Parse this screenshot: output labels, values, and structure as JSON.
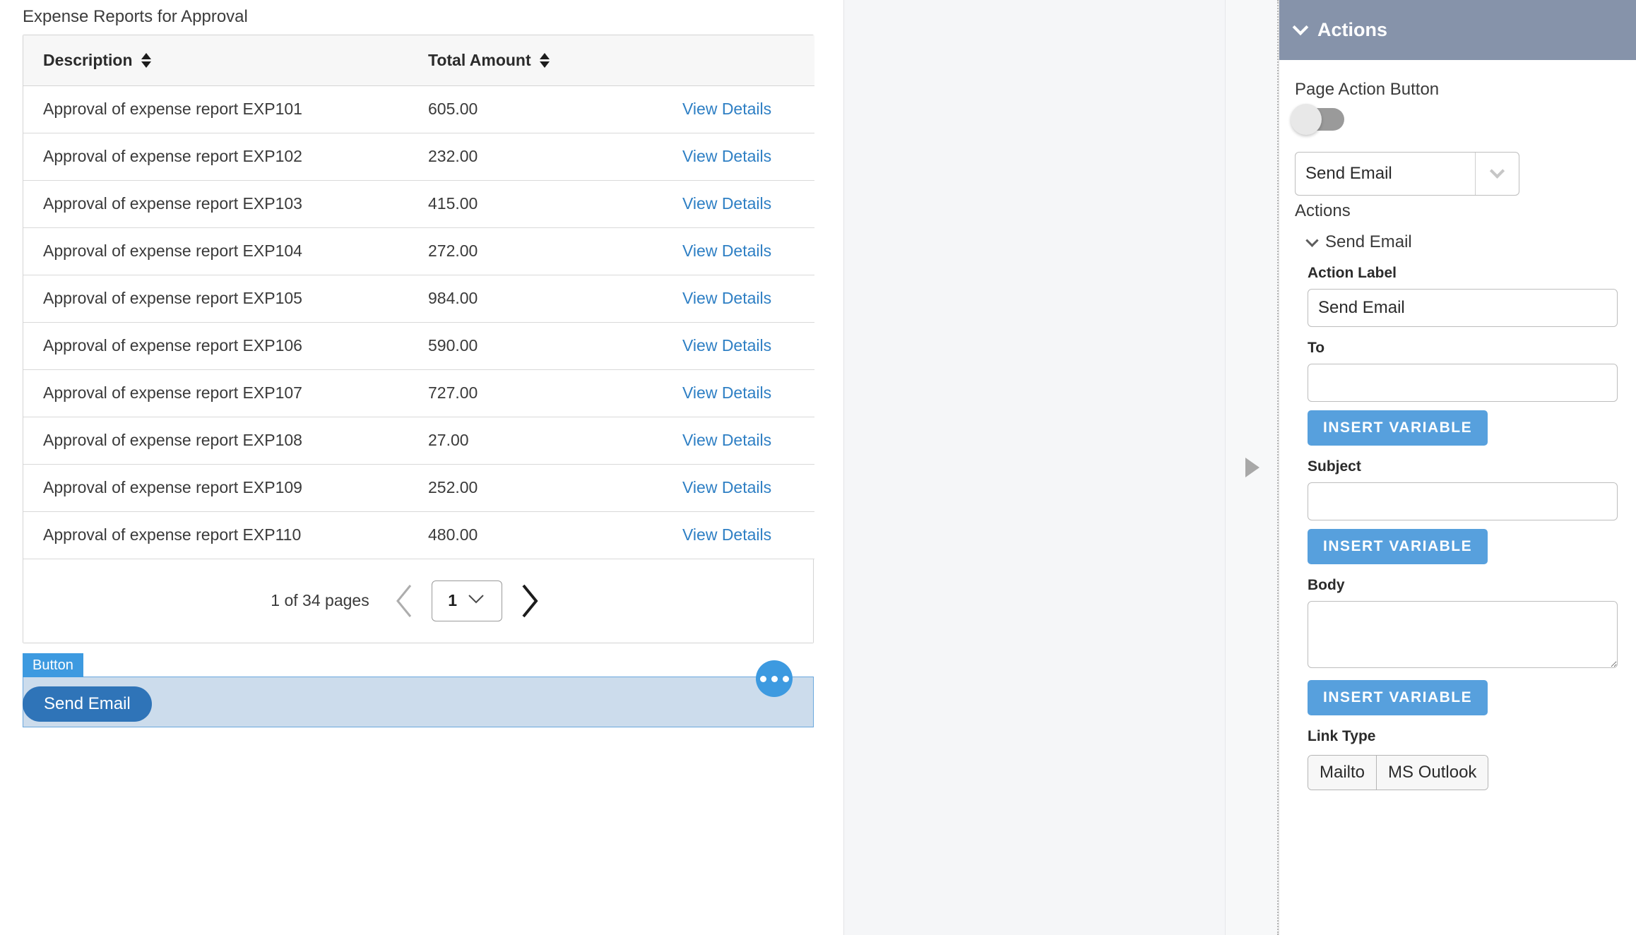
{
  "canvas": {
    "page_title": "Expense Reports for Approval",
    "table": {
      "columns": [
        {
          "label": "Description",
          "sort_icon": "sort-updown-icon"
        },
        {
          "label": "Total Amount",
          "sort_icon": "sort-updown-icon"
        },
        {
          "label": ""
        }
      ],
      "rows": [
        {
          "description": "Approval of expense report EXP101",
          "amount": "605.00",
          "action": "View Details"
        },
        {
          "description": "Approval of expense report EXP102",
          "amount": "232.00",
          "action": "View Details"
        },
        {
          "description": "Approval of expense report EXP103",
          "amount": "415.00",
          "action": "View Details"
        },
        {
          "description": "Approval of expense report EXP104",
          "amount": "272.00",
          "action": "View Details"
        },
        {
          "description": "Approval of expense report EXP105",
          "amount": "984.00",
          "action": "View Details"
        },
        {
          "description": "Approval of expense report EXP106",
          "amount": "590.00",
          "action": "View Details"
        },
        {
          "description": "Approval of expense report EXP107",
          "amount": "727.00",
          "action": "View Details"
        },
        {
          "description": "Approval of expense report EXP108",
          "amount": "27.00",
          "action": "View Details"
        },
        {
          "description": "Approval of expense report EXP109",
          "amount": "252.00",
          "action": "View Details"
        },
        {
          "description": "Approval of expense report EXP110",
          "amount": "480.00",
          "action": "View Details"
        }
      ]
    },
    "pagination": {
      "summary": "1 of 34 pages",
      "current_page": "1",
      "prev_icon": "chevron-left-icon",
      "next_icon": "chevron-right-icon",
      "page_dropdown_icon": "chevron-down-icon"
    },
    "selected_widget": {
      "badge": "Button",
      "button_label": "Send Email",
      "handle_icon": "ellipsis-icon"
    }
  },
  "gutter": {
    "expand_icon": "triangle-right-icon"
  },
  "properties": {
    "header": {
      "title": "Actions",
      "collapse_icon": "chevron-down-icon"
    },
    "page_action_button": {
      "label": "Page Action Button",
      "toggle_state": "off"
    },
    "action_select": {
      "value": "Send Email",
      "arrow_icon": "chevron-down-icon"
    },
    "actions_caption": "Actions",
    "action_group": {
      "title": "Send Email",
      "collapse_icon": "chevron-down-icon",
      "fields": {
        "action_label": {
          "label": "Action Label",
          "value": "Send Email"
        },
        "to": {
          "label": "To",
          "value": "",
          "button": "INSERT VARIABLE"
        },
        "subject": {
          "label": "Subject",
          "value": "",
          "button": "INSERT VARIABLE"
        },
        "body": {
          "label": "Body",
          "value": "",
          "button": "INSERT VARIABLE"
        },
        "link_type": {
          "label": "Link Type",
          "options": [
            "Mailto",
            "MS Outlook"
          ]
        }
      }
    }
  },
  "colors": {
    "panel_header_bg": "#8693aa",
    "accent_blue": "#57a0dd",
    "link_blue": "#2e7fc4",
    "selected_band_bg": "#ccdcec",
    "selected_band_border": "#6aa7dd",
    "pill_blue": "#2f74b8"
  }
}
